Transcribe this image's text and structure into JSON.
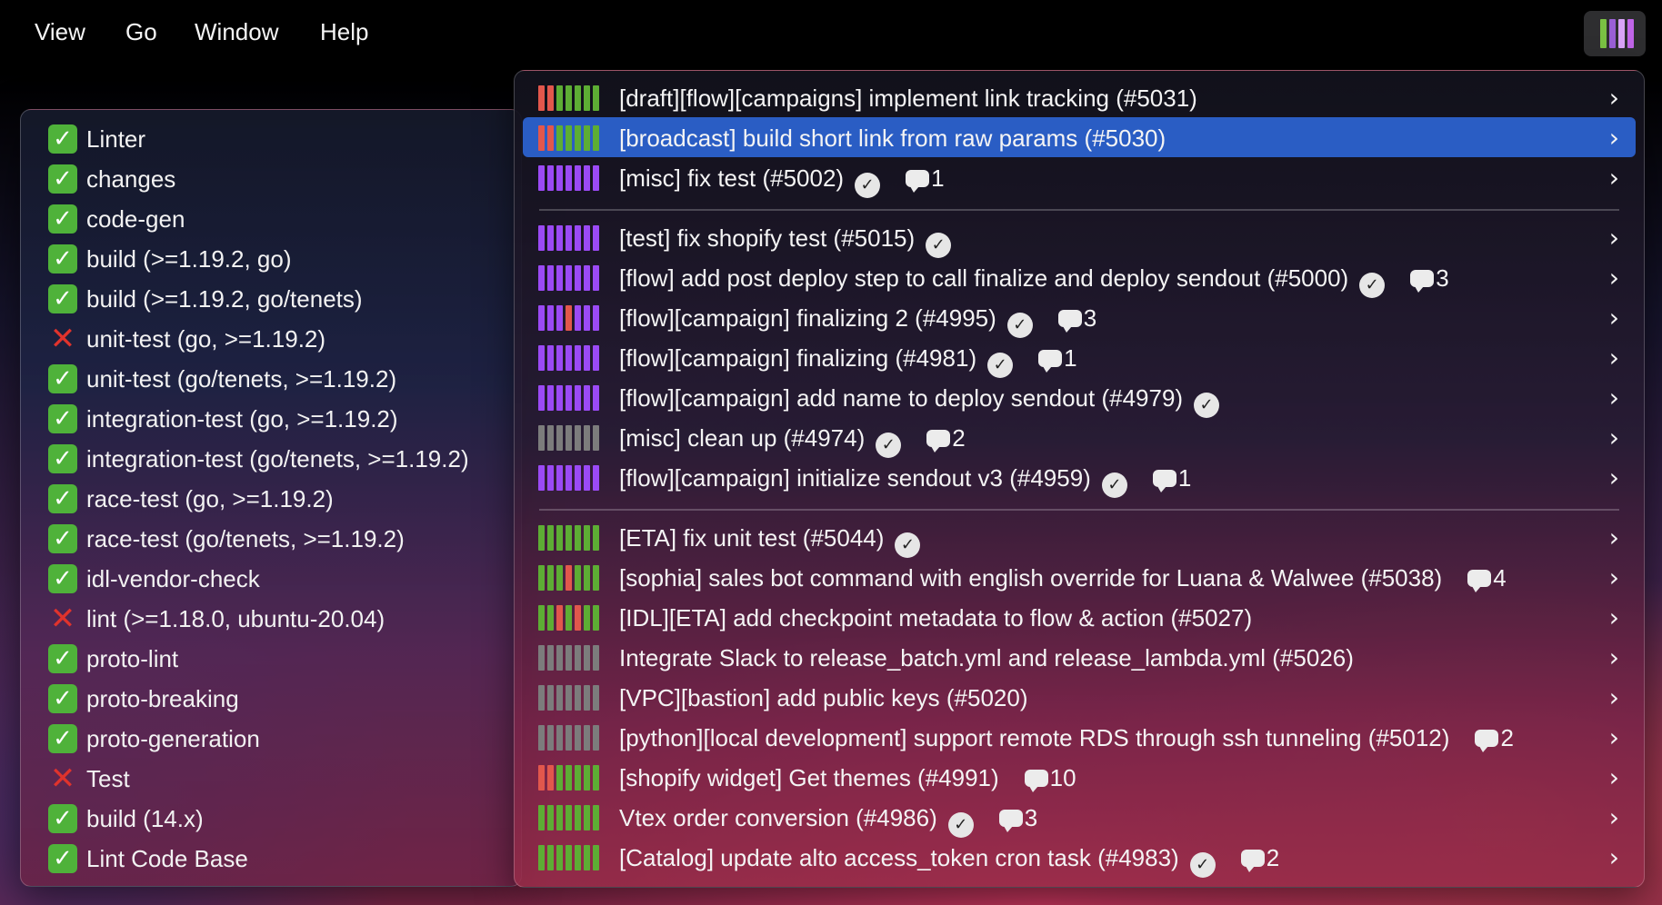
{
  "menubar": {
    "items": [
      "View",
      "Go",
      "Window",
      "Help"
    ]
  },
  "status_icon": {
    "name": "bars-status-icon",
    "colors": [
      "#7ac143",
      "#9a5fd6",
      "#d9a3f7",
      "#c065e8"
    ]
  },
  "colors": {
    "green": "#5dad34",
    "purple": "#9b4af5",
    "red": "#e2574c",
    "gray": "#7c7c7c",
    "success": "#4fb23a",
    "failure": "#e0332c",
    "selection": "#2a5dc4"
  },
  "checks": [
    {
      "label": "Linter",
      "status": "success"
    },
    {
      "label": "changes",
      "status": "success"
    },
    {
      "label": "code-gen",
      "status": "success"
    },
    {
      "label": "build (>=1.19.2, go)",
      "status": "success"
    },
    {
      "label": "build (>=1.19.2, go/tenets)",
      "status": "success"
    },
    {
      "label": "unit-test (go, >=1.19.2)",
      "status": "failure"
    },
    {
      "label": "unit-test (go/tenets, >=1.19.2)",
      "status": "success"
    },
    {
      "label": "integration-test (go, >=1.19.2)",
      "status": "success"
    },
    {
      "label": "integration-test (go/tenets, >=1.19.2)",
      "status": "success"
    },
    {
      "label": "race-test (go, >=1.19.2)",
      "status": "success"
    },
    {
      "label": "race-test (go/tenets, >=1.19.2)",
      "status": "success"
    },
    {
      "label": "idl-vendor-check",
      "status": "success"
    },
    {
      "label": "lint (>=1.18.0, ubuntu-20.04)",
      "status": "failure"
    },
    {
      "label": "proto-lint",
      "status": "success"
    },
    {
      "label": "proto-breaking",
      "status": "success"
    },
    {
      "label": "proto-generation",
      "status": "success"
    },
    {
      "label": "Test",
      "status": "failure"
    },
    {
      "label": "build (14.x)",
      "status": "success"
    },
    {
      "label": "Lint Code Base",
      "status": "success"
    }
  ],
  "pull_request_groups": [
    [
      {
        "title": "[draft][flow][campaigns] implement link tracking (#5031)",
        "bars": [
          "red",
          "red",
          "green",
          "green",
          "green",
          "green",
          "green"
        ],
        "approved": false,
        "comments": ""
      },
      {
        "title": "[broadcast] build short link from raw params (#5030)",
        "bars": [
          "red",
          "red",
          "green",
          "green",
          "green",
          "green",
          "green"
        ],
        "approved": false,
        "comments": "",
        "selected": true
      },
      {
        "title": "[misc] fix test (#5002)",
        "bars": [
          "purple",
          "purple",
          "purple",
          "purple",
          "purple",
          "purple",
          "purple"
        ],
        "approved": true,
        "comments": "1"
      }
    ],
    [
      {
        "title": "[test] fix shopify test (#5015)",
        "bars": [
          "purple",
          "purple",
          "purple",
          "purple",
          "purple",
          "purple",
          "purple"
        ],
        "approved": true,
        "comments": ""
      },
      {
        "title": "[flow] add post deploy step to call finalize and deploy sendout (#5000)",
        "bars": [
          "purple",
          "purple",
          "purple",
          "purple",
          "purple",
          "purple",
          "purple"
        ],
        "approved": true,
        "comments": "3"
      },
      {
        "title": "[flow][campaign] finalizing 2 (#4995)",
        "bars": [
          "purple",
          "purple",
          "purple",
          "red",
          "purple",
          "purple",
          "purple"
        ],
        "approved": true,
        "comments": "3"
      },
      {
        "title": "[flow][campaign] finalizing (#4981)",
        "bars": [
          "purple",
          "purple",
          "purple",
          "purple",
          "purple",
          "purple",
          "purple"
        ],
        "approved": true,
        "comments": "1"
      },
      {
        "title": "[flow][campaign] add name to deploy sendout (#4979)",
        "bars": [
          "purple",
          "purple",
          "purple",
          "purple",
          "purple",
          "purple",
          "purple"
        ],
        "approved": true,
        "comments": ""
      },
      {
        "title": "[misc] clean up (#4974)",
        "bars": [
          "gray",
          "gray",
          "gray",
          "gray",
          "gray",
          "gray",
          "gray"
        ],
        "approved": true,
        "comments": "2"
      },
      {
        "title": "[flow][campaign] initialize sendout v3 (#4959)",
        "bars": [
          "purple",
          "purple",
          "purple",
          "purple",
          "purple",
          "purple",
          "purple"
        ],
        "approved": true,
        "comments": "1"
      }
    ],
    [
      {
        "title": "[ETA] fix unit test (#5044)",
        "bars": [
          "green",
          "green",
          "green",
          "green",
          "green",
          "green",
          "green"
        ],
        "approved": true,
        "comments": ""
      },
      {
        "title": "[sophia] sales bot command with english override for Luana & Walwee (#5038)",
        "bars": [
          "green",
          "green",
          "green",
          "red",
          "green",
          "green",
          "green"
        ],
        "approved": false,
        "comments": "4"
      },
      {
        "title": "[IDL][ETA] add checkpoint metadata to flow & action (#5027)",
        "bars": [
          "green",
          "green",
          "red",
          "green",
          "red",
          "green",
          "green"
        ],
        "approved": false,
        "comments": ""
      },
      {
        "title": "Integrate Slack to release_batch.yml and release_lambda.yml (#5026)",
        "bars": [
          "gray",
          "gray",
          "gray",
          "gray",
          "gray",
          "gray",
          "gray"
        ],
        "approved": false,
        "comments": ""
      },
      {
        "title": "[VPC][bastion] add public keys (#5020)",
        "bars": [
          "gray",
          "gray",
          "gray",
          "gray",
          "gray",
          "gray",
          "gray"
        ],
        "approved": false,
        "comments": ""
      },
      {
        "title": "[python][local development] support remote RDS through ssh tunneling (#5012)",
        "bars": [
          "gray",
          "gray",
          "gray",
          "gray",
          "gray",
          "gray",
          "gray"
        ],
        "approved": false,
        "comments": "2"
      },
      {
        "title": "[shopify widget] Get themes (#4991)",
        "bars": [
          "red",
          "red",
          "green",
          "green",
          "green",
          "green",
          "green"
        ],
        "approved": false,
        "comments": "10"
      },
      {
        "title": "Vtex order conversion (#4986)",
        "bars": [
          "green",
          "green",
          "green",
          "green",
          "green",
          "green",
          "green"
        ],
        "approved": true,
        "comments": "3"
      },
      {
        "title": "[Catalog] update alto access_token cron task (#4983)",
        "bars": [
          "green",
          "green",
          "green",
          "green",
          "green",
          "green",
          "green"
        ],
        "approved": true,
        "comments": "2"
      }
    ]
  ],
  "icons": {
    "approved": "verified-check-icon",
    "comment": "comment-bubble-icon",
    "chevron": "chevron-right-icon",
    "success": "green-check-icon",
    "failure": "red-x-icon"
  }
}
